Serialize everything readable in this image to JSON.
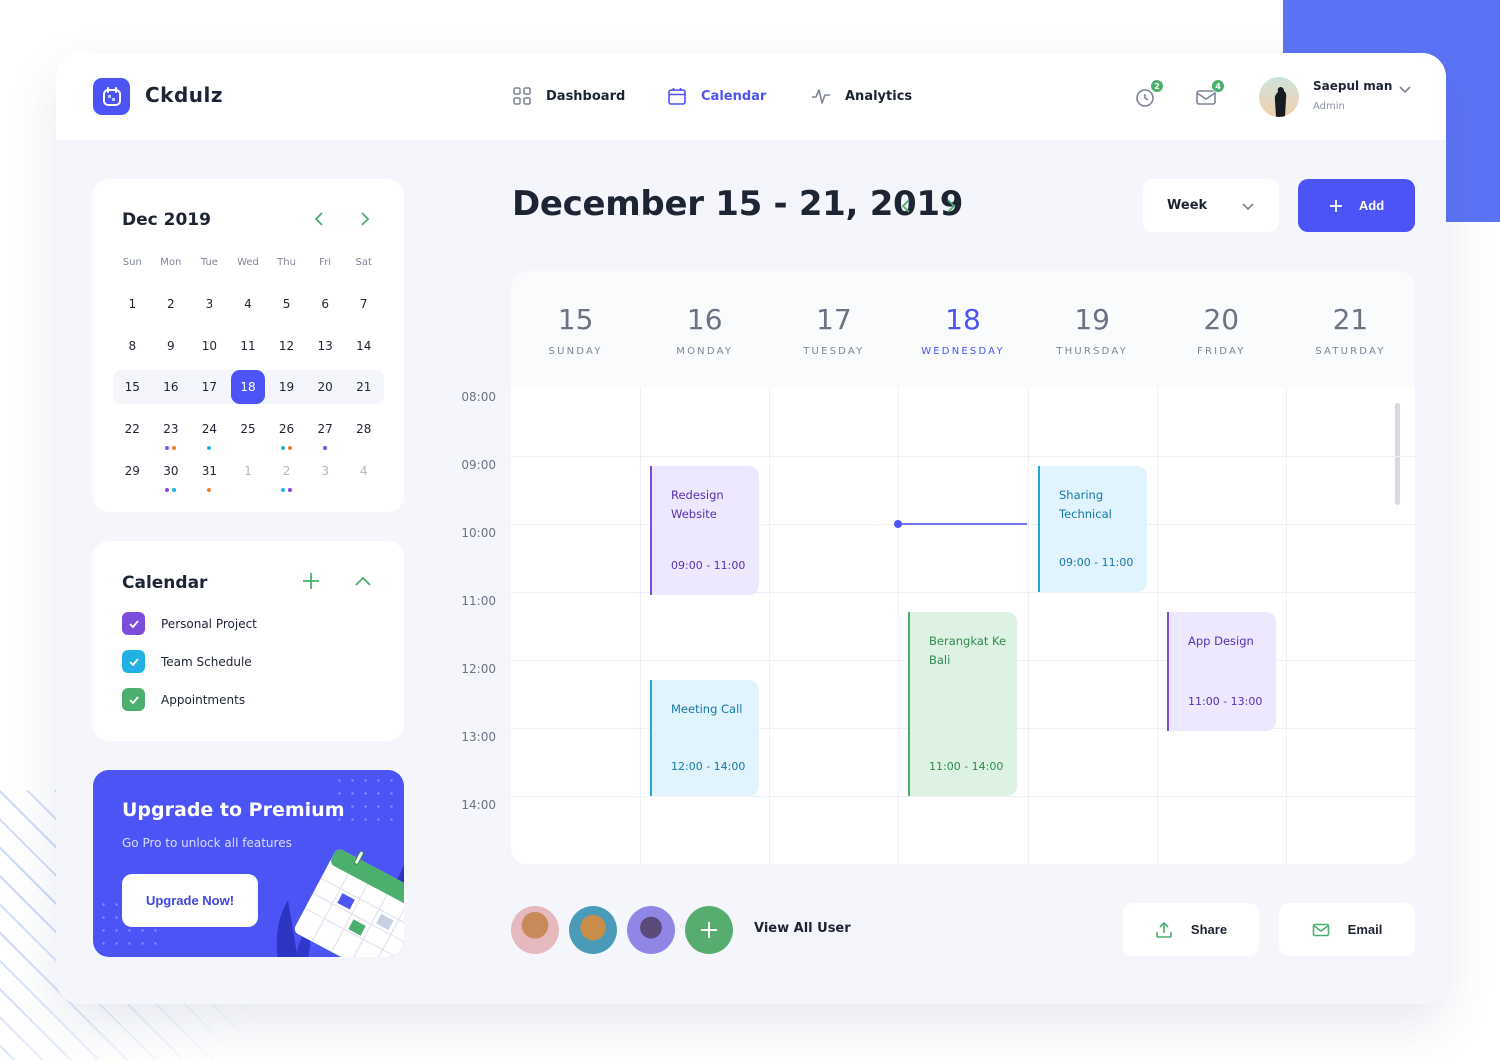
{
  "app": {
    "brand": "Ckdulz"
  },
  "nav": {
    "items": [
      {
        "label": "Dashboard",
        "icon": "grid-icon",
        "active": false
      },
      {
        "label": "Calendar",
        "icon": "calendar-icon",
        "active": true
      },
      {
        "label": "Analytics",
        "icon": "pulse-icon",
        "active": false
      }
    ]
  },
  "header": {
    "notifications": {
      "icon": "clock-icon",
      "count": "2"
    },
    "messages": {
      "icon": "mail-icon",
      "count": "4"
    },
    "user": {
      "name": "Saepul man",
      "role": "Admin"
    }
  },
  "mini_calendar": {
    "title": "Dec 2019",
    "weekdays": [
      "Sun",
      "Mon",
      "Tue",
      "Wed",
      "Thu",
      "Fri",
      "Sat"
    ],
    "weeks": [
      [
        {
          "d": "1"
        },
        {
          "d": "2"
        },
        {
          "d": "3"
        },
        {
          "d": "4"
        },
        {
          "d": "5"
        },
        {
          "d": "6"
        },
        {
          "d": "7"
        }
      ],
      [
        {
          "d": "8"
        },
        {
          "d": "9"
        },
        {
          "d": "10"
        },
        {
          "d": "11"
        },
        {
          "d": "12"
        },
        {
          "d": "13"
        },
        {
          "d": "14"
        }
      ],
      [
        {
          "d": "15"
        },
        {
          "d": "16"
        },
        {
          "d": "17"
        },
        {
          "d": "18",
          "selected": true
        },
        {
          "d": "19"
        },
        {
          "d": "20"
        },
        {
          "d": "21"
        }
      ],
      [
        {
          "d": "22"
        },
        {
          "d": "23",
          "dots": [
            "#7c4ddb",
            "#f27a2b"
          ]
        },
        {
          "d": "24",
          "dots": [
            "#21b0e3"
          ]
        },
        {
          "d": "25"
        },
        {
          "d": "26",
          "dots": [
            "#21b0e3",
            "#f27a2b"
          ]
        },
        {
          "d": "27",
          "dots": [
            "#7c4ddb"
          ]
        },
        {
          "d": "28"
        }
      ],
      [
        {
          "d": "29"
        },
        {
          "d": "30",
          "dots": [
            "#7c4ddb",
            "#21b0e3"
          ]
        },
        {
          "d": "31",
          "dots": [
            "#f27a2b"
          ]
        },
        {
          "d": "1",
          "muted": true
        },
        {
          "d": "2",
          "muted": true,
          "dots": [
            "#21b0e3",
            "#7c4ddb"
          ]
        },
        {
          "d": "3",
          "muted": true
        },
        {
          "d": "4",
          "muted": true
        }
      ]
    ]
  },
  "calendar_list": {
    "title": "Calendar",
    "items": [
      {
        "label": "Personal Project",
        "color": "#7c4ddb",
        "checked": true
      },
      {
        "label": "Team Schedule",
        "color": "#21b0e3",
        "checked": true
      },
      {
        "label": "Appointments",
        "color": "#4caf6e",
        "checked": true
      }
    ]
  },
  "promo": {
    "title": "Upgrade to Premium",
    "subtitle": "Go Pro to unlock all features",
    "button": "Upgrade Now!"
  },
  "week_view": {
    "range_title": "December 15 - 21, 2019",
    "view_select": "Week",
    "add_label": "Add",
    "days": [
      {
        "num": "15",
        "name": "SUNDAY"
      },
      {
        "num": "16",
        "name": "MONDAY"
      },
      {
        "num": "17",
        "name": "TUESDAY"
      },
      {
        "num": "18",
        "name": "WEDNESDAY",
        "today": true
      },
      {
        "num": "19",
        "name": "THURSDAY"
      },
      {
        "num": "20",
        "name": "FRIDAY"
      },
      {
        "num": "21",
        "name": "SATURDAY"
      }
    ],
    "hours": [
      "08:00",
      "09:00",
      "10:00",
      "11:00",
      "12:00",
      "13:00",
      "14:00"
    ],
    "current_time": {
      "day": 3,
      "hour": 10.0
    },
    "events": [
      {
        "title": "Redesign Website",
        "time": "09:00 - 11:00",
        "day": 1,
        "start": 9,
        "end": 10.9,
        "bg": "#ede8fd",
        "bar": "#7c4ddb",
        "fg": "#5a2fb8"
      },
      {
        "title": "Meeting Call",
        "time": "12:00 - 14:00",
        "day": 1,
        "start": 12.15,
        "end": 13.85,
        "bg": "#e1f3fd",
        "bar": "#21a6dc",
        "fg": "#1478a8"
      },
      {
        "title": "Berangkat Ke Bali",
        "time": "11:00 - 14:00",
        "day": 3,
        "start": 11.15,
        "end": 13.85,
        "bg": "#def2e4",
        "bar": "#4caf6e",
        "fg": "#2f8a4c"
      },
      {
        "title": "Sharing Technical",
        "time": "09:00 - 11:00",
        "day": 4,
        "start": 9,
        "end": 10.85,
        "bg": "#e1f3fd",
        "bar": "#21a6dc",
        "fg": "#1478a8"
      },
      {
        "title": "App Design",
        "time": "11:00 - 13:00",
        "day": 5,
        "start": 11.15,
        "end": 12.9,
        "bg": "#ede8fd",
        "bar": "#7c4ddb",
        "fg": "#5a2fb8"
      }
    ]
  },
  "footer": {
    "view_all": "View All User",
    "share": "Share",
    "email": "Email"
  }
}
